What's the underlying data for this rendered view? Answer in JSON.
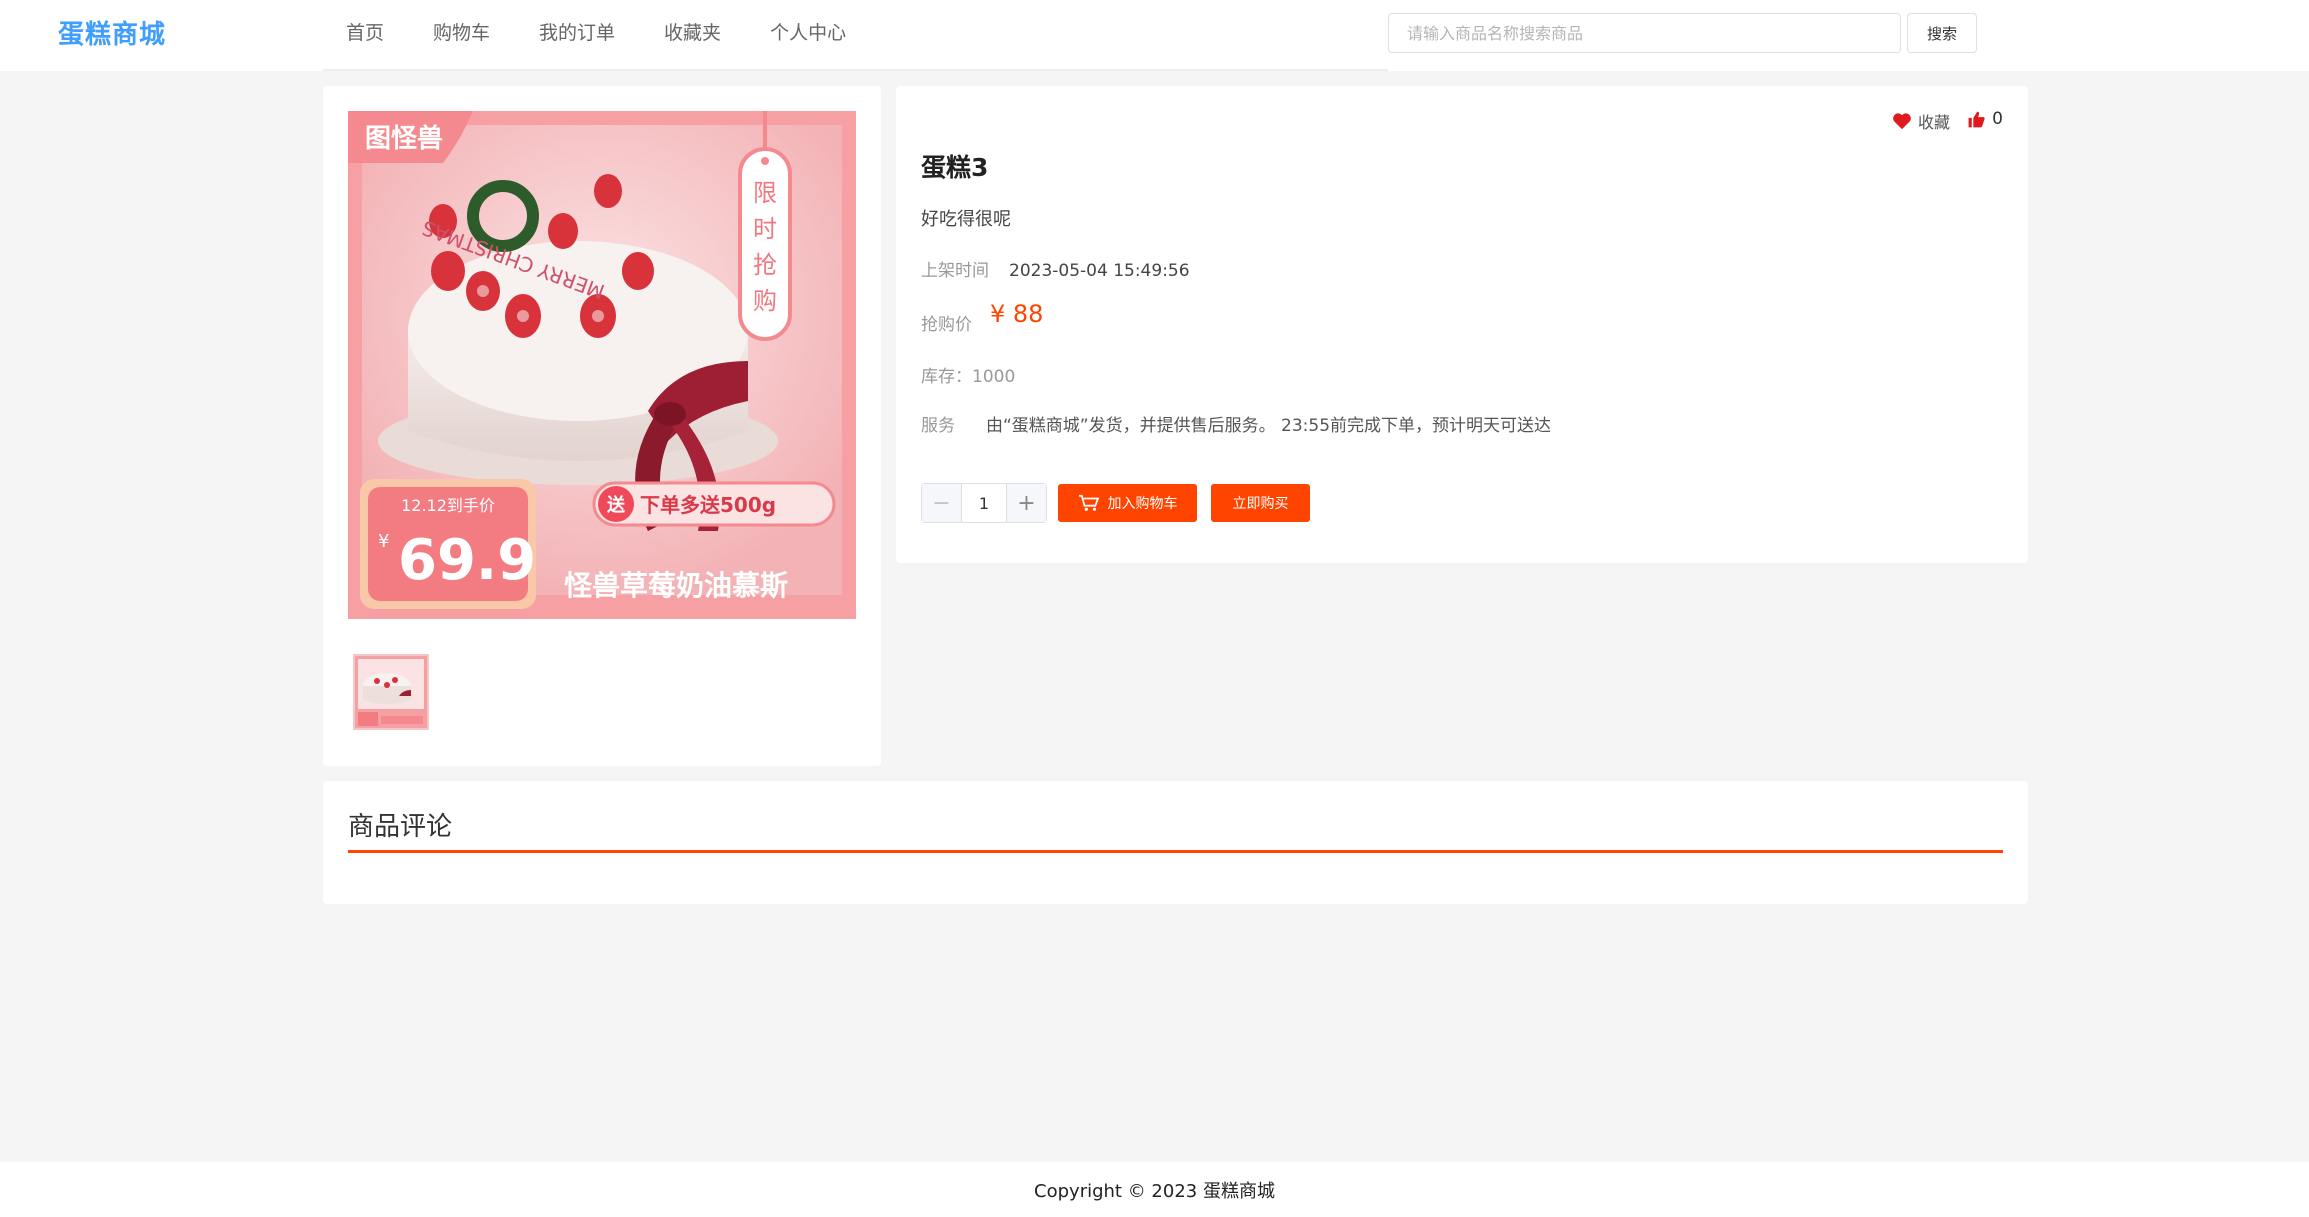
{
  "header": {
    "logo": "蛋糕商城",
    "nav": [
      "首页",
      "购物车",
      "我的订单",
      "收藏夹",
      "个人中心"
    ],
    "search_placeholder": "请输入商品名称搜索商品",
    "search_button": "搜索"
  },
  "gallery": {
    "image_texts": {
      "brand": "图怪兽",
      "tag": "限时抢购",
      "promo_caption": "12.12到手价",
      "promo_currency": "¥",
      "promo_price": "69.9",
      "gift_badge": "送",
      "gift_text": "下单多送500g",
      "product_name": "怪兽草莓奶油慕斯",
      "decoration": "MERRY CHRISTMAS"
    }
  },
  "product": {
    "favorite_label": "收藏",
    "like_count": "0",
    "title": "蛋糕3",
    "description": "好吃得很呢",
    "listing_label": "上架时间",
    "listing_time": "2023-05-04 15:49:56",
    "price_label": "抢购价",
    "price": "¥ 88",
    "stock": "库存：1000",
    "service_label": "服务",
    "service_text": "由“蛋糕商城”发货，并提供售后服务。 23:55前完成下单，预计明天可送达",
    "quantity": "1",
    "minus_symbol": "−",
    "plus_symbol": "+",
    "add_to_cart": "加入购物车",
    "buy_now": "立即购买"
  },
  "reviews": {
    "title": "商品评论"
  },
  "footer": {
    "copyright": "Copyright © 2023 蛋糕商城"
  },
  "colors": {
    "accent": "#ff4400",
    "logo": "#409eff",
    "background": "#f5f5f5"
  }
}
